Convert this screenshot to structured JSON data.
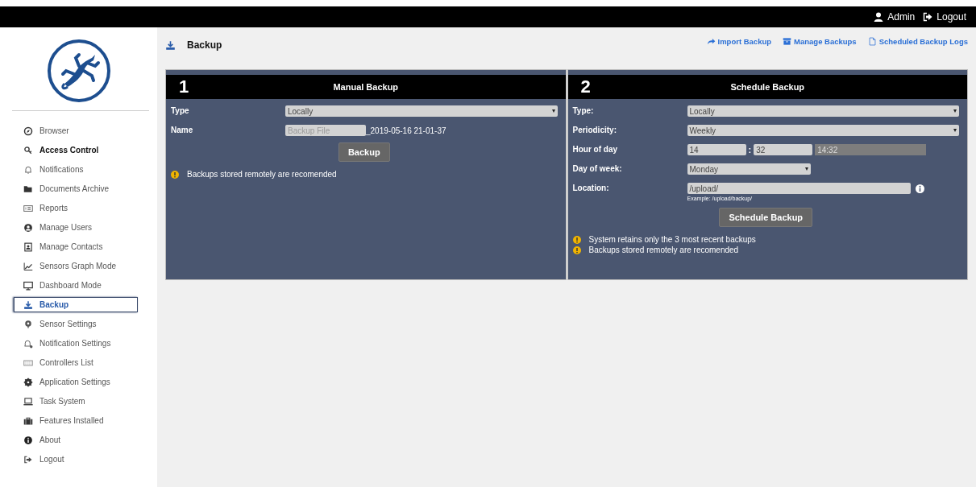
{
  "topbar": {
    "user": "Admin",
    "logout": "Logout"
  },
  "sidebar": {
    "items": [
      {
        "label": "Browser",
        "selected": false,
        "hovered": false
      },
      {
        "label": "Access Control",
        "selected": false,
        "hovered": true
      },
      {
        "label": "Notifications",
        "selected": false,
        "hovered": false
      },
      {
        "label": "Documents Archive",
        "selected": false,
        "hovered": false
      },
      {
        "label": "Reports",
        "selected": false,
        "hovered": false
      },
      {
        "label": "Manage Users",
        "selected": false,
        "hovered": false
      },
      {
        "label": "Manage Contacts",
        "selected": false,
        "hovered": false
      },
      {
        "label": "Sensors Graph Mode",
        "selected": false,
        "hovered": false
      },
      {
        "label": "Dashboard Mode",
        "selected": false,
        "hovered": false
      },
      {
        "label": "Backup",
        "selected": true,
        "hovered": false
      },
      {
        "label": "Sensor Settings",
        "selected": false,
        "hovered": false
      },
      {
        "label": "Notification Settings",
        "selected": false,
        "hovered": false
      },
      {
        "label": "Controllers List",
        "selected": false,
        "hovered": false
      },
      {
        "label": "Application Settings",
        "selected": false,
        "hovered": false
      },
      {
        "label": "Task System",
        "selected": false,
        "hovered": false
      },
      {
        "label": "Features Installed",
        "selected": false,
        "hovered": false
      },
      {
        "label": "About",
        "selected": false,
        "hovered": false
      },
      {
        "label": "Logout",
        "selected": false,
        "hovered": false
      }
    ]
  },
  "page": {
    "title": "Backup",
    "links": [
      {
        "label": "Import Backup"
      },
      {
        "label": "Manage Backups"
      },
      {
        "label": "Scheduled Backup Logs"
      }
    ]
  },
  "panels": [
    {
      "number": "1",
      "title": "Manual Backup",
      "rows": [
        {
          "kind": "select",
          "label": "Type",
          "value": "Locally"
        },
        {
          "kind": "name",
          "label": "Name",
          "placeholder": "Backup File",
          "suffix": "_2019-05-16 21-01-37"
        }
      ],
      "button": "Backup",
      "notes": [
        "Backups stored remotely are recomended"
      ]
    },
    {
      "number": "2",
      "title": "Schedule Backup",
      "rows": [
        {
          "kind": "select",
          "label": "Type:",
          "value": "Locally"
        },
        {
          "kind": "select",
          "label": "Periodicity:",
          "value": "Weekly"
        },
        {
          "kind": "time",
          "label": "Hour of day",
          "hour": "14",
          "minute": "32",
          "separator": ":",
          "result": "14:32"
        },
        {
          "kind": "short_select",
          "label": "Day of week:",
          "value": "Monday"
        },
        {
          "kind": "location",
          "label": "Location:",
          "value": "/upload/",
          "hint": "Example: /upload/backup/"
        }
      ],
      "button": "Schedule Backup",
      "notes": [
        "System retains only the 3 most recent backups",
        "Backups stored remotely are recomended"
      ]
    }
  ]
}
